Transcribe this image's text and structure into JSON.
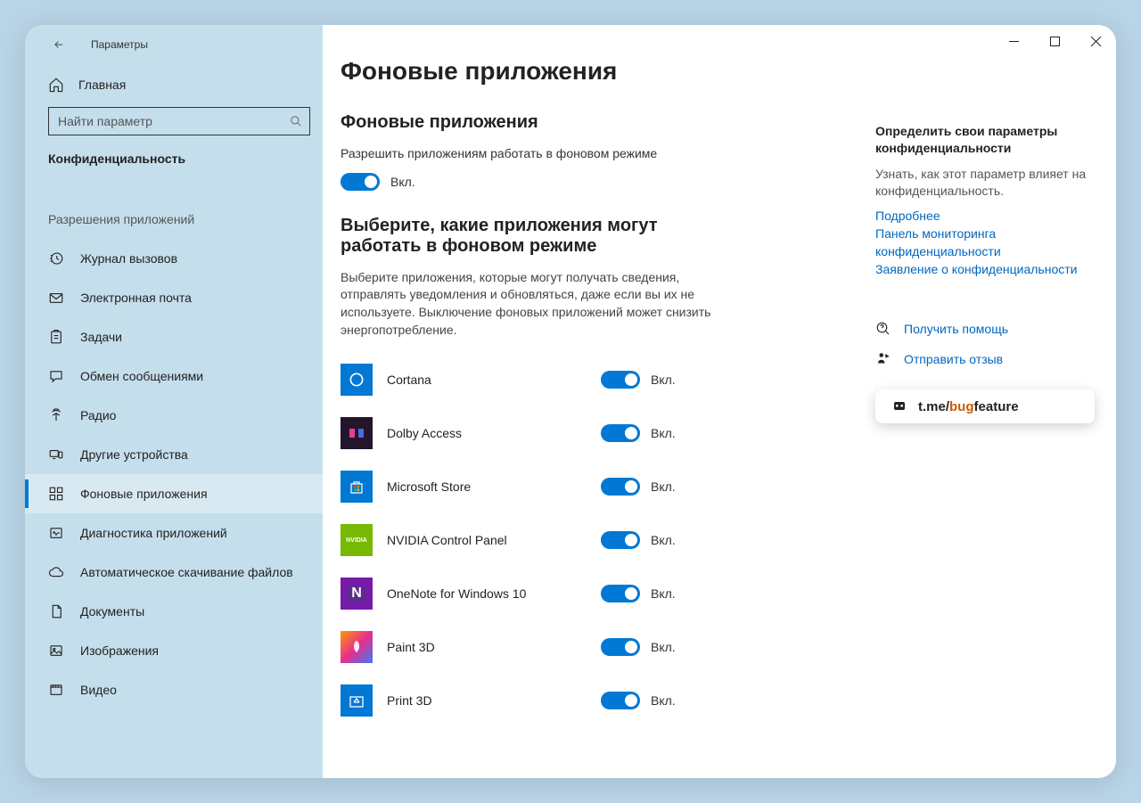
{
  "app": {
    "title": "Параметры"
  },
  "nav": {
    "home": "Главная",
    "search_placeholder": "Найти параметр",
    "category": "Конфиденциальность",
    "section": "Разрешения приложений",
    "items": [
      {
        "label": "Журнал вызовов"
      },
      {
        "label": "Электронная почта"
      },
      {
        "label": "Задачи"
      },
      {
        "label": "Обмен сообщениями"
      },
      {
        "label": "Радио"
      },
      {
        "label": "Другие устройства"
      },
      {
        "label": "Фоновые приложения",
        "selected": true
      },
      {
        "label": "Диагностика приложений"
      },
      {
        "label": "Автоматическое скачивание файлов"
      },
      {
        "label": "Документы"
      },
      {
        "label": "Изображения"
      },
      {
        "label": "Видео"
      }
    ]
  },
  "page": {
    "title": "Фоновые приложения",
    "section1_title": "Фоновые приложения",
    "allow_label": "Разрешить приложениям работать в фоновом режиме",
    "allow_state": "Вкл.",
    "section2_title": "Выберите, какие приложения могут работать в фоновом режиме",
    "section2_desc": "Выберите приложения, которые могут получать сведения, отправлять уведомления и обновляться, даже если вы их не используете. Выключение фоновых приложений может снизить энергопотребление.",
    "on_label": "Вкл.",
    "apps": [
      {
        "name": "Cortana"
      },
      {
        "name": "Dolby Access"
      },
      {
        "name": "Microsoft Store"
      },
      {
        "name": "NVIDIA Control Panel"
      },
      {
        "name": "OneNote for Windows 10"
      },
      {
        "name": "Paint 3D"
      },
      {
        "name": "Print 3D"
      }
    ]
  },
  "side": {
    "heading": "Определить свои параметры конфиденциальности",
    "body": "Узнать, как этот параметр влияет на конфиденциальность.",
    "links": [
      "Подробнее",
      "Панель мониторинга конфиденциальности",
      "Заявление о конфиденциальности"
    ],
    "help": "Получить помощь",
    "feedback": "Отправить отзыв"
  },
  "badge": {
    "prefix": "t.me/",
    "orange": "bug",
    "suffix": "feature"
  }
}
